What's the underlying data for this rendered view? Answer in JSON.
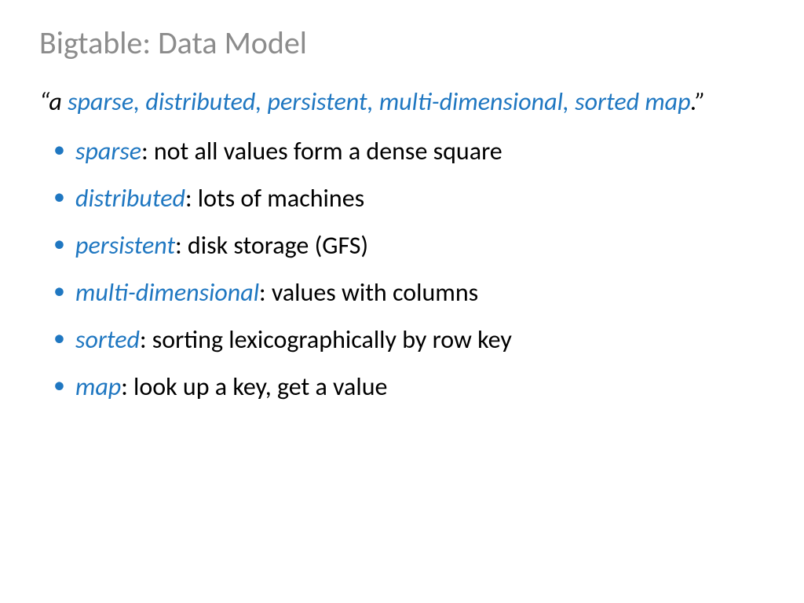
{
  "title": "Bigtable: Data Model",
  "quote": {
    "q_open": "“",
    "w_a": "a ",
    "w_sparse": "sparse",
    "c1": ", ",
    "w_distributed": "distributed",
    "c2": ", ",
    "w_persistent": "persistent, ",
    "w_multi": "multi-dimensional",
    "c3": ", ",
    "w_sorted": "sorted ",
    "w_map": "map",
    "period": ".",
    "q_close": "”"
  },
  "bullets": [
    {
      "term": "sparse",
      "desc": ": not all values form a dense square"
    },
    {
      "term": "distributed",
      "desc": ": lots of machines"
    },
    {
      "term": "persistent",
      "desc": ": disk storage (GFS)"
    },
    {
      "term": "multi-dimensional",
      "desc": ": values with columns"
    },
    {
      "term": "sorted",
      "desc": ": sorting lexicographically by row key"
    },
    {
      "term": "map",
      "desc": ": look up a key, get a value"
    }
  ]
}
